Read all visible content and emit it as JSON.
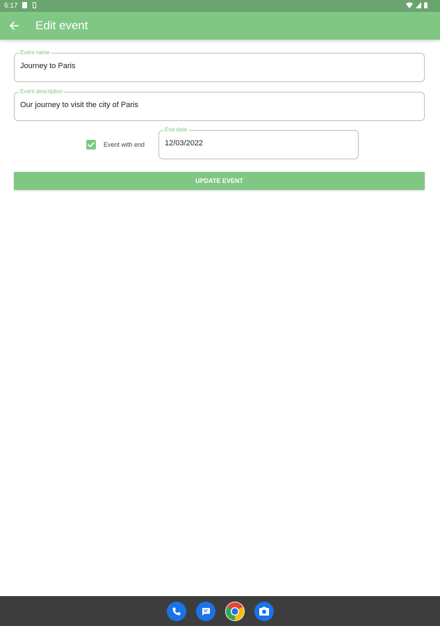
{
  "status_bar": {
    "time": "6:17",
    "icons": [
      "sim-card-icon",
      "battery-saver-icon",
      "wifi-icon",
      "cell-signal-icon",
      "battery-icon"
    ]
  },
  "app_bar": {
    "title": "Edit event",
    "back_icon": "arrow-back-icon"
  },
  "form": {
    "event_name": {
      "label": "Event name",
      "value": "Journey to Paris"
    },
    "event_description": {
      "label": "Event description",
      "value": "Our journey to visit the city of Paris"
    },
    "event_with_end": {
      "label": "Event with end",
      "checked": true
    },
    "end_date": {
      "label": "End date",
      "value": "12/03/2022"
    },
    "update_button": "UPDATE EVENT"
  },
  "dock": {
    "apps": [
      "phone-app-icon",
      "messages-app-icon",
      "chrome-app-icon",
      "camera-app-icon"
    ]
  },
  "colors": {
    "primary": "#81c784",
    "status_bar": "#6aa46f",
    "dock": "#3d3d3d"
  }
}
